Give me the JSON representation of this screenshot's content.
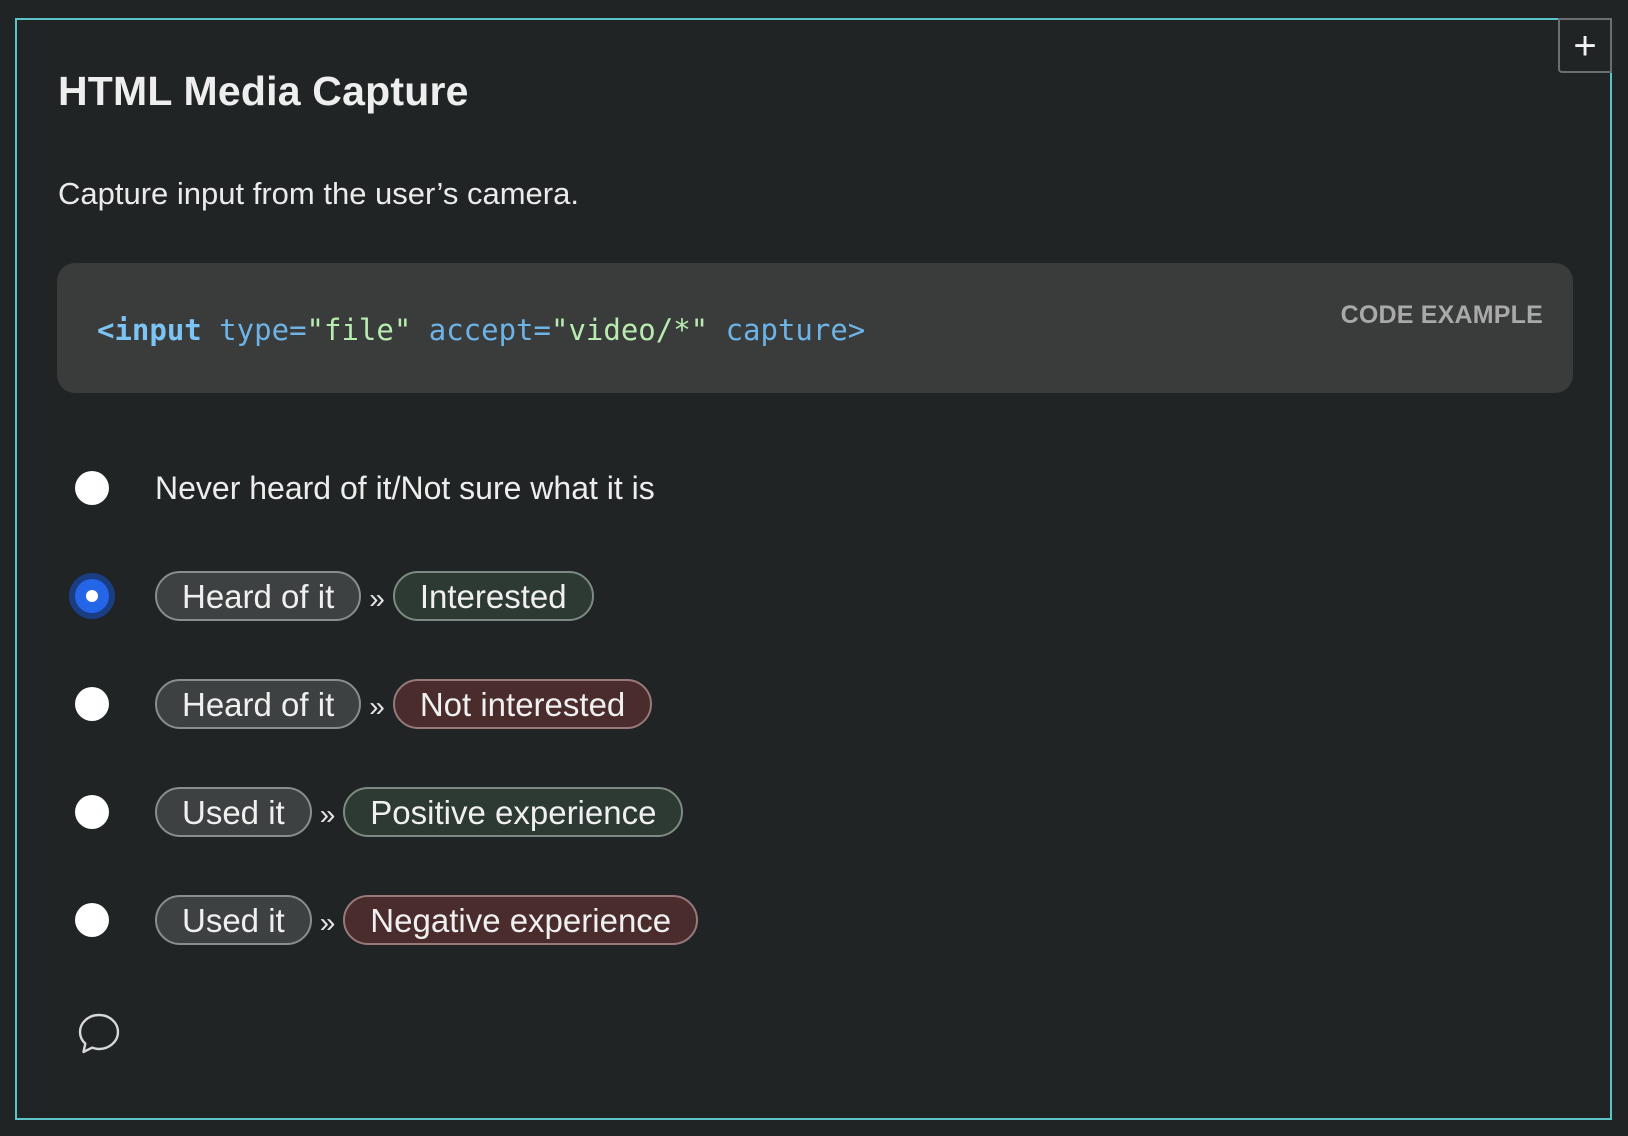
{
  "card": {
    "title": "HTML Media Capture",
    "description": "Capture input from the user’s camera.",
    "expand_icon": "plus-icon",
    "expand_label": "+",
    "code_example": {
      "label": "CODE EXAMPLE",
      "tag_open": "<input",
      "attr1_name": " type=",
      "attr1_value": "\"file\"",
      "attr2_name": " accept=",
      "attr2_value": "\"video/*\"",
      "attr3": " capture>"
    },
    "separator": "»",
    "options": [
      {
        "text": "Never heard of it/Not sure what it is",
        "checked": false
      },
      {
        "chip1": "Heard of it",
        "chip2": "Interested",
        "chip2_tone": "green",
        "checked": true
      },
      {
        "chip1": "Heard of it",
        "chip2": "Not interested",
        "chip2_tone": "red",
        "checked": false
      },
      {
        "chip1": "Used it",
        "chip2": "Positive experience",
        "chip2_tone": "green",
        "checked": false
      },
      {
        "chip1": "Used it",
        "chip2": "Negative experience",
        "chip2_tone": "red",
        "checked": false
      }
    ],
    "comment_icon": "speech-bubble-icon"
  },
  "colors": {
    "background": "#202425",
    "card_border": "#5cc4c6",
    "code_background": "#3a3c3c",
    "radio_checked": "#2566e8",
    "chip_green": "#2d3a33",
    "chip_red": "#4a2c2d"
  }
}
